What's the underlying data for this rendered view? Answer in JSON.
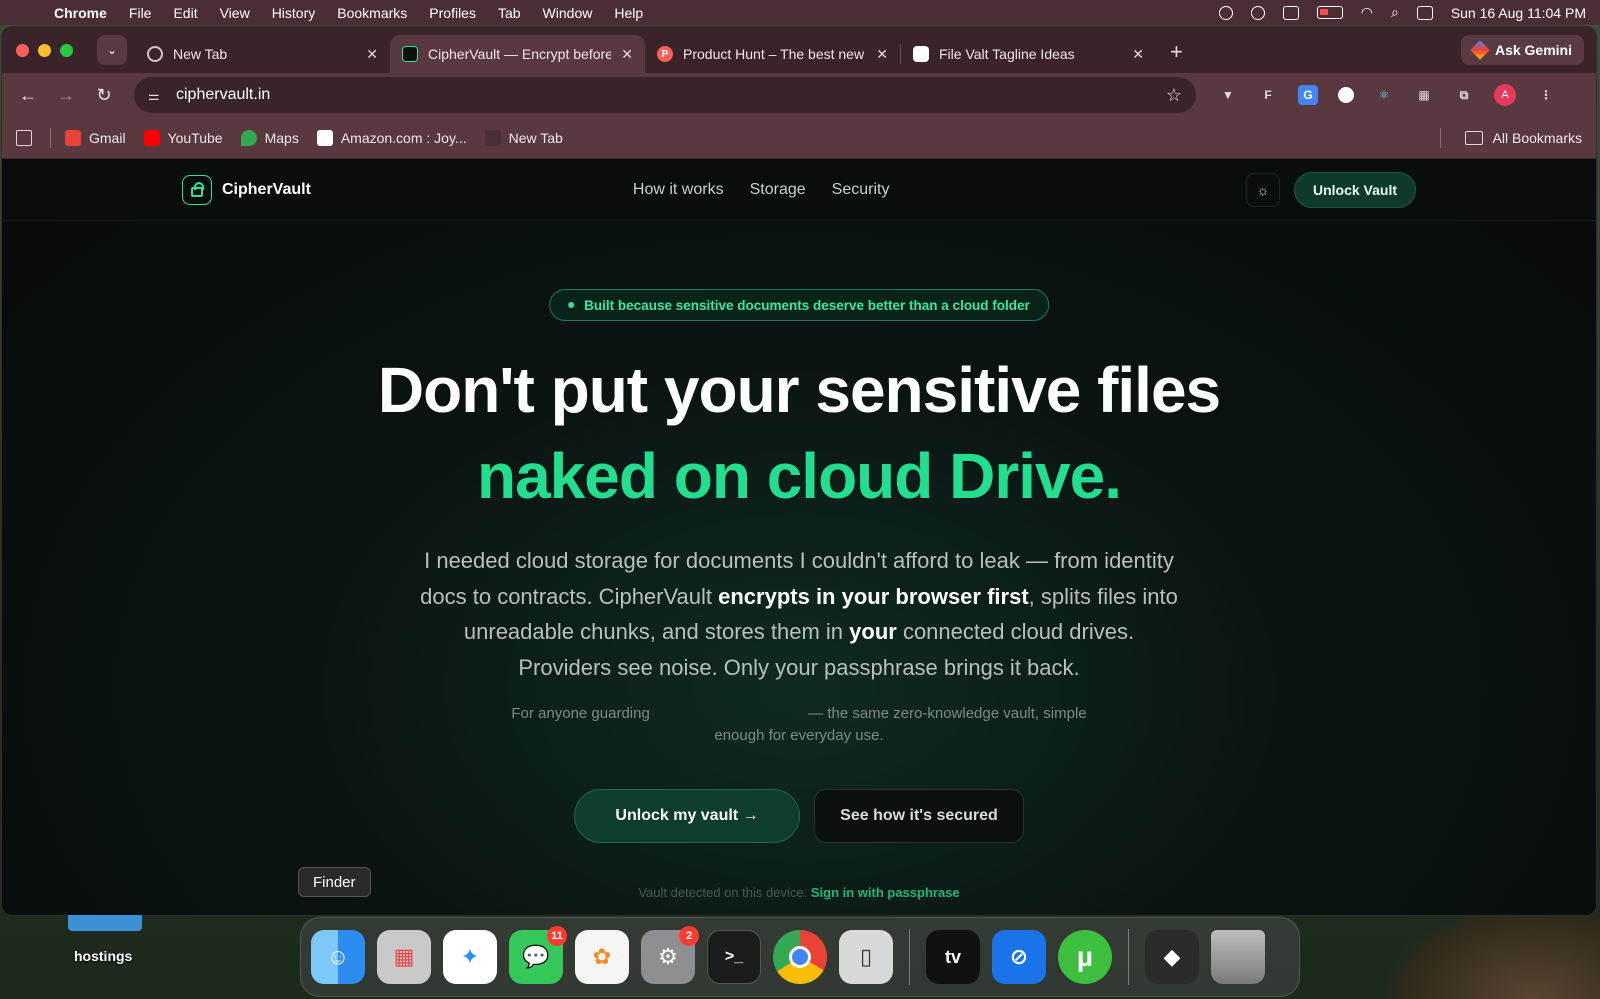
{
  "menubar": {
    "app": "Chrome",
    "items": [
      "File",
      "Edit",
      "View",
      "History",
      "Bookmarks",
      "Profiles",
      "Tab",
      "Window",
      "Help"
    ],
    "clock": "Sun 16 Aug  11:04 PM"
  },
  "tabs": [
    {
      "title": "New Tab",
      "favicon_color": "#9aa0a6",
      "active": false
    },
    {
      "title": "CipherVault — Encrypt before",
      "favicon_color": "#2de39a",
      "active": true
    },
    {
      "title": "Product Hunt – The best new",
      "favicon_color": "#ff6154",
      "active": false
    },
    {
      "title": "File Valt Tagline Ideas",
      "favicon_color": "#ffffff",
      "active": false
    }
  ],
  "ask_gemini": "Ask Gemini",
  "omnibox": {
    "url": "ciphervault.in"
  },
  "bookmarks": {
    "items": [
      {
        "label": "Gmail",
        "color": "#ea4335"
      },
      {
        "label": "YouTube",
        "color": "#ff0000"
      },
      {
        "label": "Maps",
        "color": "#34a853"
      },
      {
        "label": "Amazon.com : Joy...",
        "color": "#ffffff"
      },
      {
        "label": "New Tab",
        "color": "#3a3a3a"
      }
    ],
    "all": "All Bookmarks"
  },
  "site": {
    "brand": "CipherVault",
    "nav": [
      "How it works",
      "Storage",
      "Security"
    ],
    "unlock": "Unlock Vault",
    "pill": "Built because sensitive documents deserve better than a cloud folder",
    "title_line1": "Don't put your sensitive files",
    "title_line2": "naked on cloud Drive.",
    "desc": {
      "p1": "I needed cloud storage for documents I couldn't afford to leak — from identity docs to contracts. CipherVault ",
      "b1": "encrypts in your browser first",
      "p2": ", splits files into unreadable chunks, and stores them in ",
      "b2": "your",
      "p3": " connected cloud drives. Providers see noise. Only your passphrase brings it back."
    },
    "sub_a": "For anyone guarding",
    "sub_b": "— the same zero-knowledge vault, simple enough for everyday use.",
    "cta_primary": "Unlock my vault →",
    "cta_secondary": "See how it's secured",
    "device_note": "Vault detected on this device.",
    "device_link": "Sign in with passphrase"
  },
  "dock": {
    "tooltip": "Finder",
    "desktop_label": "hostings",
    "apps": [
      {
        "name": "finder",
        "color": "#3aa0f0",
        "glyph": "☺"
      },
      {
        "name": "launchpad",
        "color": "#c9c9c9",
        "glyph": "▦"
      },
      {
        "name": "safari",
        "color": "#1e90ff",
        "glyph": "✦"
      },
      {
        "name": "messages",
        "color": "#34c759",
        "glyph": "💬",
        "badge": "11"
      },
      {
        "name": "photos",
        "color": "#f5f5f5",
        "glyph": "✿"
      },
      {
        "name": "system-settings",
        "color": "#8e8e93",
        "glyph": "⚙",
        "badge": "2"
      },
      {
        "name": "terminal",
        "color": "#1c1c1c",
        "glyph": ">_"
      },
      {
        "name": "chrome",
        "color": "#fbbc05",
        "glyph": "◉"
      },
      {
        "name": "iphone-mirroring",
        "color": "#d8d8d8",
        "glyph": "▯"
      },
      {
        "name": "apple-tv",
        "color": "#111111",
        "glyph": "tv"
      },
      {
        "name": "remote-desktop",
        "color": "#1a73e8",
        "glyph": "⊘"
      },
      {
        "name": "utorrent",
        "color": "#3fbf3f",
        "glyph": "µ"
      },
      {
        "name": "archive",
        "color": "#2b2b2b",
        "glyph": "◆"
      },
      {
        "name": "trash",
        "color": "#9a9a9a",
        "glyph": "🗑"
      }
    ]
  }
}
